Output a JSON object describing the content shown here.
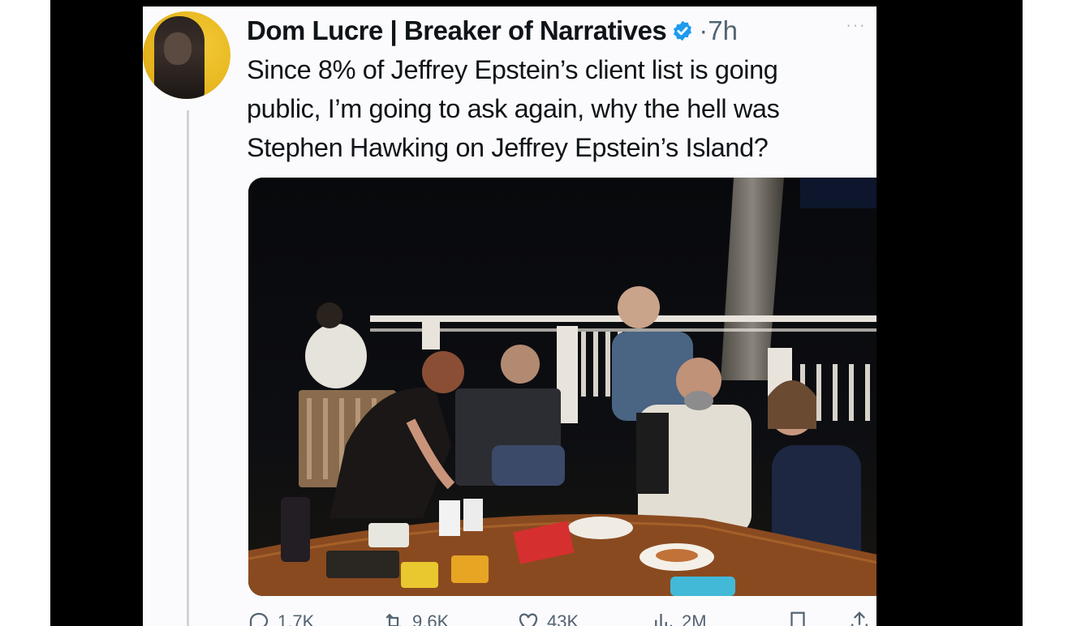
{
  "tweet": {
    "author_name": "Dom Lucre | Breaker of Narratives",
    "separator": "·",
    "time": "7h",
    "more_label": "···",
    "text_lines": [
      "Since 8% of Jeffrey Epstein’s client list is going",
      "public, I’m going to ask again, why the hell was",
      "Stephen Hawking on Jeffrey Epstein’s Island?"
    ]
  },
  "actions": {
    "reply_count": "1.7K",
    "retweet_count": "9.6K",
    "like_count": "43K",
    "views_count": "2M"
  },
  "colors": {
    "verified": "#1d9bf0",
    "text": "#0f1419",
    "secondary": "#536471",
    "avatar_bg": "#e8b820"
  },
  "icons": [
    "verified-badge-icon",
    "more-icon",
    "reply-icon",
    "retweet-icon",
    "like-icon",
    "views-icon",
    "bookmark-icon",
    "share-icon"
  ]
}
